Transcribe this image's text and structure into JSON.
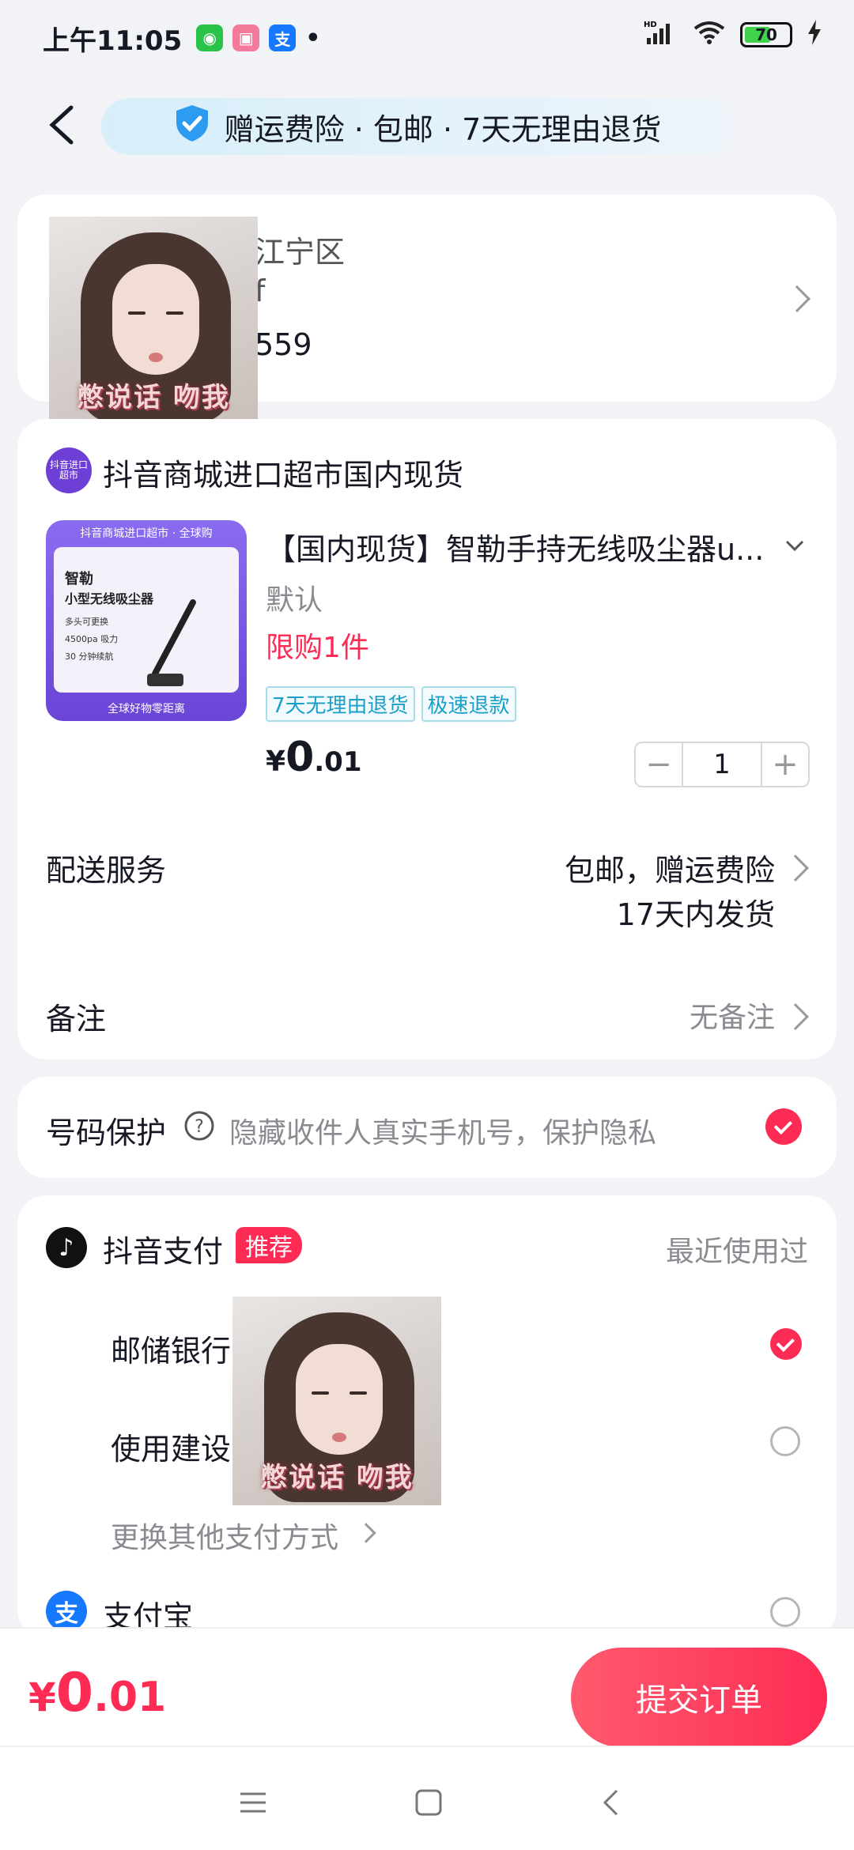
{
  "statusbar": {
    "time": "上午11:05",
    "battery": "70"
  },
  "banner": {
    "text": "赠运费险 · 包邮 · 7天无理由退货"
  },
  "address": {
    "line1": "江宁区",
    "line2": "f",
    "line3": "559"
  },
  "sticker": {
    "caption": "憋说话 吻我"
  },
  "shop": {
    "logo_text": "抖音进口超市",
    "name": "抖音商城进口超市国内现货"
  },
  "product": {
    "image": {
      "header": "抖音商城进口超市 · 全球购",
      "title1": "智勒",
      "title2": "小型无线吸尘器",
      "bullets": [
        "多头可更换",
        "4500pa 吸力",
        "30 分钟续航"
      ],
      "footer": "全球好物零距离"
    },
    "title": "【国内现货】智勒手持无线吸尘器u...",
    "variant": "默认",
    "limit": "限购1件",
    "tags": [
      "7天无理由退货",
      "极速退款"
    ],
    "price_symbol": "¥",
    "price_int": "0",
    "price_dec": ".01",
    "quantity": "1"
  },
  "shipping": {
    "label": "配送服务",
    "value1": "包邮，赠运费险",
    "value2": "17天内发货"
  },
  "note": {
    "label": "备注",
    "value": "无备注"
  },
  "privacy": {
    "label": "号码保护",
    "desc": "隐藏收件人真实手机号，保护隐私"
  },
  "payment": {
    "douyin_label": "抖音支付",
    "badge": "推荐",
    "recent": "最近使用过",
    "options": [
      "邮储银行",
      "使用建设"
    ],
    "more": "更换其他支付方式",
    "alipay_label": "支付宝"
  },
  "bottom": {
    "total_symbol": "¥",
    "total_int": "0",
    "total_dec": ".01",
    "submit": "提交订单"
  },
  "colors": {
    "accent": "#fe2c55",
    "tag_blue": "#1a9fc7",
    "background": "#f2f3f7"
  }
}
